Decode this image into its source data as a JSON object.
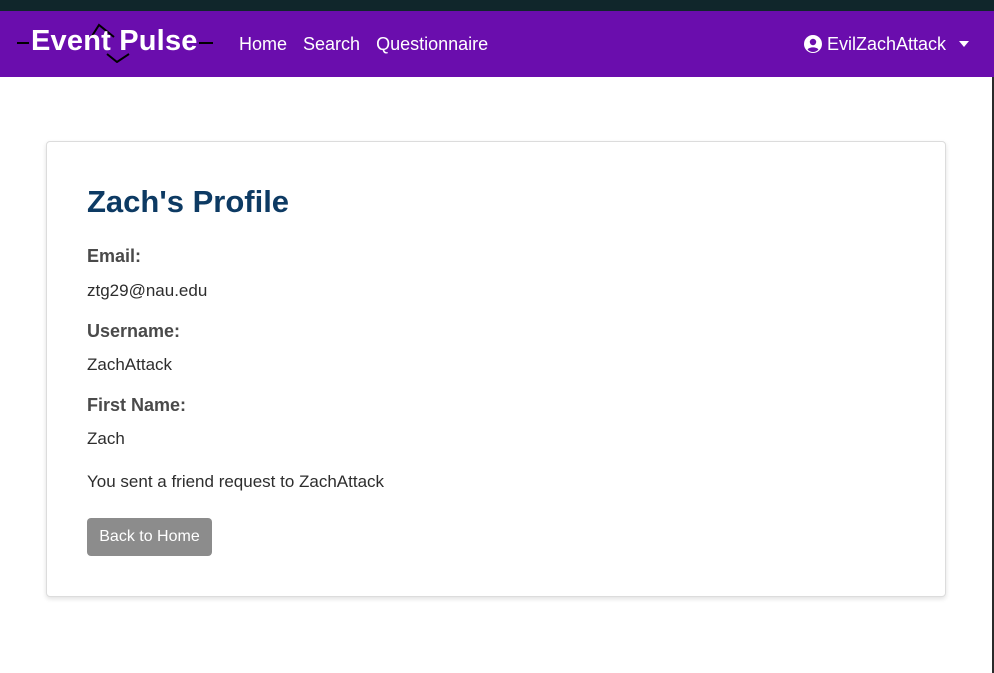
{
  "brand": {
    "name": "Event Pulse"
  },
  "nav": {
    "links": [
      {
        "label": "Home"
      },
      {
        "label": "Search"
      },
      {
        "label": "Questionnaire"
      }
    ],
    "user": {
      "name": "EvilZachAttack",
      "icon": "user-circle-icon"
    }
  },
  "profile": {
    "title": "Zach's Profile",
    "email_label": "Email:",
    "email_value": "ztg29@nau.edu",
    "username_label": "Username:",
    "username_value": "ZachAttack",
    "firstname_label": "First Name:",
    "firstname_value": "Zach",
    "status": "You sent a friend request to ZachAttack",
    "back_button": "Back to Home"
  },
  "colors": {
    "navbar": "#6a0dad",
    "top_strip": "#10262b",
    "title": "#0d3a63",
    "button": "#8c8c8c"
  }
}
